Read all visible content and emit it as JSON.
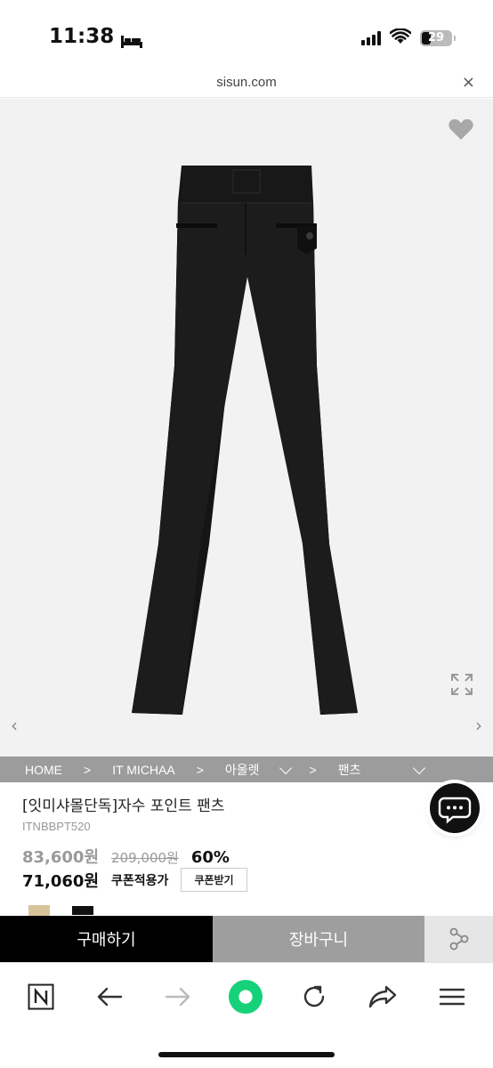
{
  "status_bar": {
    "time": "11:38",
    "battery": "29"
  },
  "browser": {
    "url": "sisun.com",
    "close": "×"
  },
  "gallery": {
    "prev": "‹",
    "next": "›"
  },
  "breadcrumb": [
    "HOME",
    ">",
    "IT MICHAA",
    ">",
    "아울렛",
    ">",
    "팬츠"
  ],
  "product": {
    "title": "[잇미샤몰단독]자수 포인트 팬츠",
    "code": "ITNBBPT520",
    "sale_price": "83,600원",
    "list_price": "209,000원",
    "discount": "60%",
    "final_price": "71,060원",
    "coupon_label": "쿠폰적용가",
    "coupon_button": "쿠폰받기"
  },
  "actions": {
    "buy": "구매하기",
    "cart": "장바구니"
  }
}
